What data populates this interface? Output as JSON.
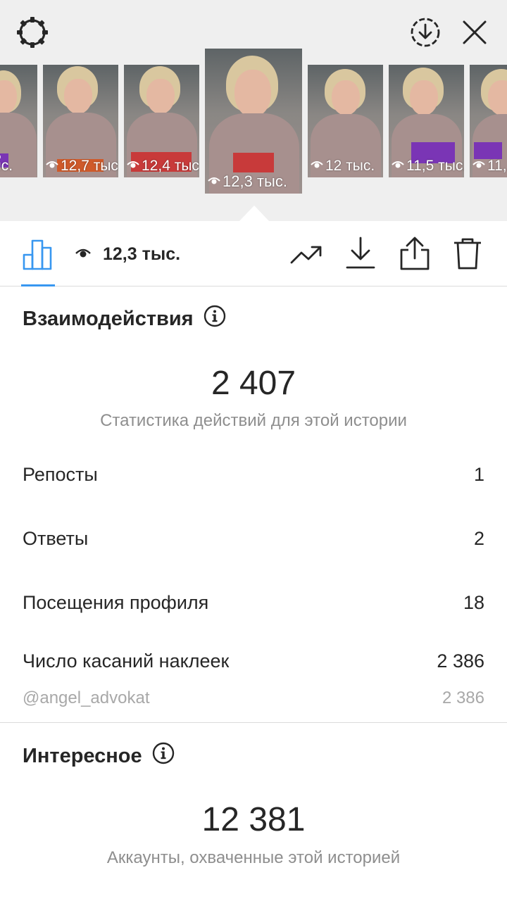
{
  "header": {
    "settings_icon": "gear-icon",
    "download_icon": "circled-download-icon",
    "close_icon": "close-icon"
  },
  "stories": [
    {
      "views": "тыс."
    },
    {
      "views": "12,7 тыс."
    },
    {
      "views": "12,4 тыс."
    },
    {
      "views": "12,3 тыс.",
      "active": true
    },
    {
      "views": "12 тыс."
    },
    {
      "views": "11,5 тыс."
    },
    {
      "views": "11,"
    }
  ],
  "toolbar": {
    "views_label": "12,3 тыс.",
    "icons": [
      "bar-chart-icon",
      "eye-icon",
      "trending-icon",
      "download-icon",
      "share-icon",
      "trash-icon"
    ],
    "accent": "#3897f0"
  },
  "interactions": {
    "title": "Взаимодействия",
    "total": "2 407",
    "subtitle": "Статистика действий для этой истории",
    "rows": [
      {
        "label": "Репосты",
        "value": "1"
      },
      {
        "label": "Ответы",
        "value": "2"
      },
      {
        "label": "Посещения профиля",
        "value": "18"
      },
      {
        "label": "Число касаний наклеек",
        "value": "2 386"
      }
    ],
    "sub_row": {
      "label": "@angel_advokat",
      "value": "2 386"
    }
  },
  "discovery": {
    "title": "Интересное",
    "total": "12 381",
    "subtitle": "Аккаунты, охваченные этой историей"
  }
}
